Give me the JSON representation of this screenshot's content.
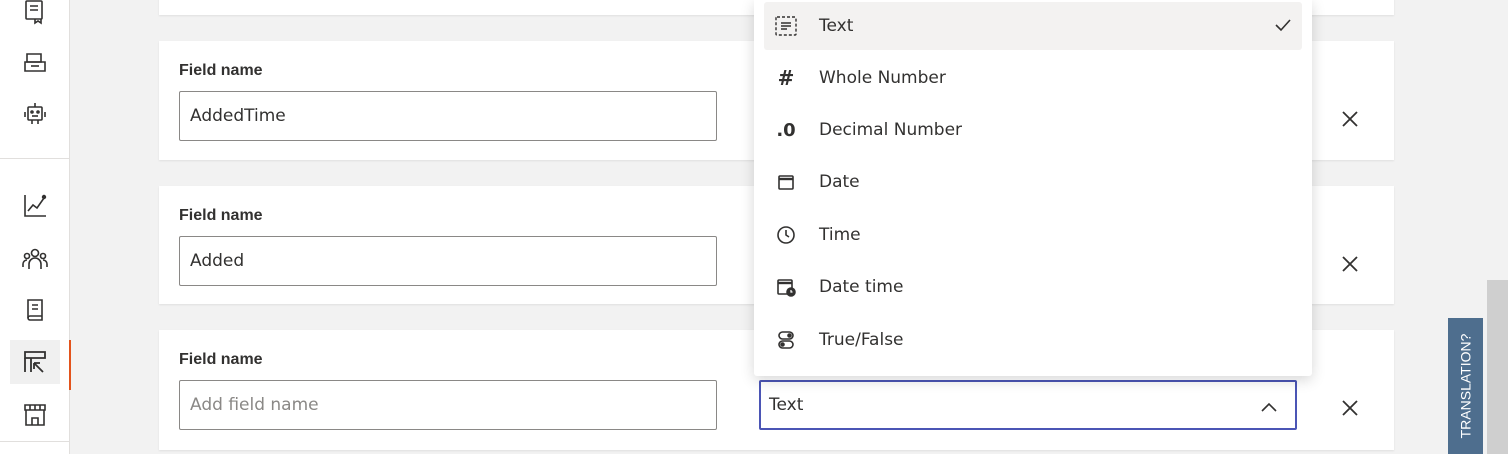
{
  "sidebar": {
    "items": [
      {
        "icon": "copy-table-icon"
      },
      {
        "icon": "database-icon"
      },
      {
        "icon": "robot-icon"
      },
      {
        "icon": "line-chart-icon"
      },
      {
        "icon": "people-icon"
      },
      {
        "icon": "book-icon"
      },
      {
        "icon": "table-import-icon",
        "active": true
      },
      {
        "icon": "storefront-icon"
      }
    ]
  },
  "fields": [
    {
      "label": "Field name",
      "value": "AddedTime",
      "placeholder": ""
    },
    {
      "label": "Field name",
      "value": "Added",
      "placeholder": ""
    },
    {
      "label": "Field name",
      "value": "",
      "placeholder": "Add field name"
    }
  ],
  "type_select": {
    "value": "Text"
  },
  "dropdown": {
    "options": [
      {
        "label": "Text",
        "icon": "text-field-icon",
        "selected": true
      },
      {
        "label": "Whole Number",
        "icon": "hash-icon",
        "glyph": "#"
      },
      {
        "label": "Decimal Number",
        "icon": "decimal-icon",
        "glyph": ".0"
      },
      {
        "label": "Date",
        "icon": "calendar-icon"
      },
      {
        "label": "Time",
        "icon": "clock-icon"
      },
      {
        "label": "Date time",
        "icon": "calendar-clock-icon"
      },
      {
        "label": "True/False",
        "icon": "toggle-icon"
      }
    ]
  },
  "feedback": {
    "label": "TRANSLATION?"
  },
  "colors": {
    "accent": "#4b55b5",
    "active_indicator": "#e3541c",
    "feedback_bg": "#4e6e8e"
  }
}
